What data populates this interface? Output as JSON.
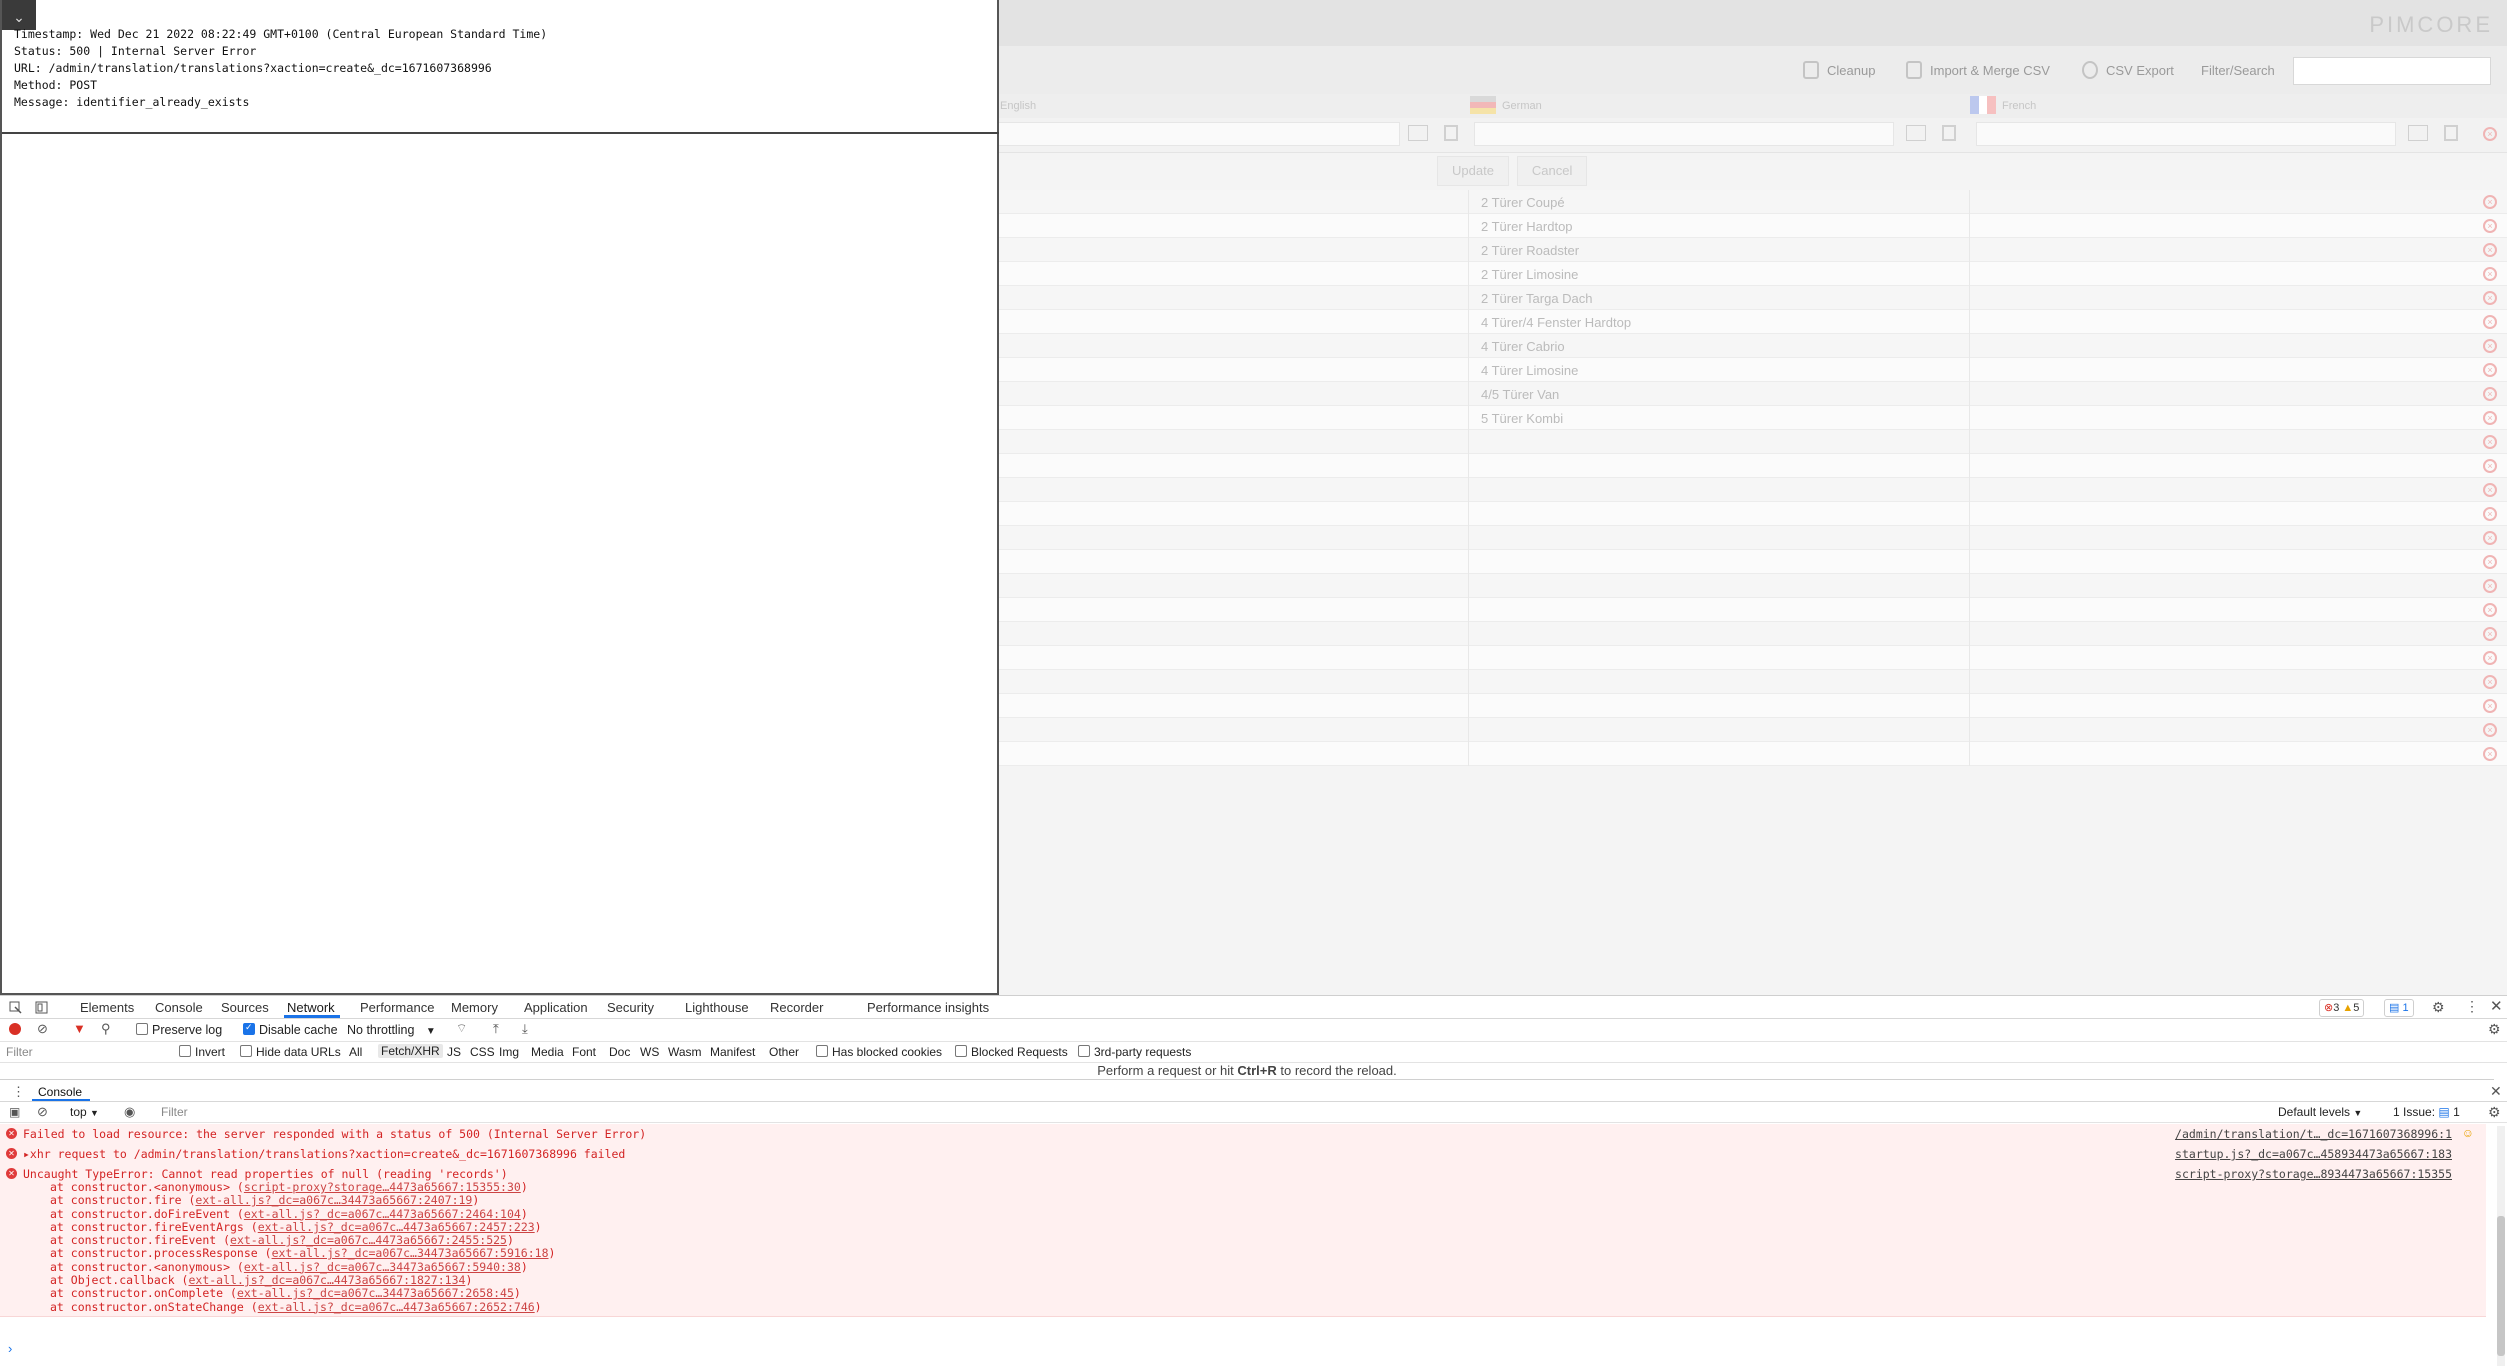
{
  "app": {
    "logo_text": "PIMCORE",
    "toolbar": {
      "cleanup": "Cleanup",
      "import_merge": "Import & Merge CSV",
      "csv_export": "CSV Export",
      "filter_label": "Filter/Search"
    },
    "columns": {
      "english": "English",
      "german": "German",
      "french": "French"
    },
    "row_editor": {
      "update": "Update",
      "cancel": "Cancel"
    },
    "rows": [
      "2 Türer Coupé",
      "2 Türer Hardtop",
      "2 Türer Roadster",
      "2 Türer Limosine",
      "2 Türer Targa Dach",
      "4 Türer/4 Fenster Hardtop",
      "4 Türer Cabrio",
      "4 Türer Limosine",
      "4/5 Türer Van",
      "5 Türer Kombi",
      "",
      "",
      "",
      "",
      "",
      "",
      "",
      "",
      "",
      "",
      "",
      "",
      "",
      ""
    ]
  },
  "error": {
    "timestamp": "Timestamp: Wed Dec 21 2022 08:22:49 GMT+0100 (Central European Standard Time)",
    "status": "Status: 500 | Internal Server Error",
    "url": "URL: /admin/translation/translations?xaction=create&_dc=1671607368996",
    "method": "Method: POST",
    "message": "Message: identifier_already_exists"
  },
  "devtools": {
    "tabs": [
      "Elements",
      "Console",
      "Sources",
      "Network",
      "Performance",
      "Memory",
      "Application",
      "Security",
      "Lighthouse",
      "Recorder",
      "Performance insights"
    ],
    "counts": {
      "errors": "3",
      "warnings": "5",
      "messages": "1"
    },
    "network": {
      "preserve_log": "Preserve log",
      "disable_cache": "Disable cache",
      "throttling": "No throttling"
    },
    "filter": {
      "placeholder": "Filter",
      "invert": "Invert",
      "hide_data_urls": "Hide data URLs",
      "types": [
        "All",
        "Fetch/XHR",
        "JS",
        "CSS",
        "Img",
        "Media",
        "Font",
        "Doc",
        "WS",
        "Wasm",
        "Manifest",
        "Other"
      ],
      "blocked_cookies": "Has blocked cookies",
      "blocked_requests": "Blocked Requests",
      "third_party": "3rd-party requests"
    },
    "record_msg_pre": "Perform a request or hit ",
    "record_msg_key": "Ctrl+R",
    "record_msg_post": " to record the reload.",
    "drawer_tab": "Console",
    "console": {
      "context": "top",
      "filter_placeholder": "Filter",
      "levels": "Default levels",
      "issues": "1 Issue:",
      "issues_count": "1"
    },
    "messages": [
      {
        "text": "Failed to load resource: the server responded with a status of 500 (Internal Server Error)",
        "source": "/admin/translation/t…_dc=1671607368996:1"
      },
      {
        "text": "▸xhr request to /admin/translation/translations?xaction=create&_dc=1671607368996 failed",
        "source": "startup.js?_dc=a067c…458934473a65667:183"
      },
      {
        "text": "Uncaught TypeError: Cannot read properties of null (reading 'records')",
        "source": "script-proxy?storage…8934473a65667:15355"
      }
    ],
    "stack": [
      {
        "pre": "at constructor.<anonymous> (",
        "link": "script-proxy?storage…4473a65667:15355:30",
        "post": ")"
      },
      {
        "pre": "at constructor.fire (",
        "link": "ext-all.js?_dc=a067c…34473a65667:2407:19",
        "post": ")"
      },
      {
        "pre": "at constructor.doFireEvent (",
        "link": "ext-all.js?_dc=a067c…4473a65667:2464:104",
        "post": ")"
      },
      {
        "pre": "at constructor.fireEventArgs (",
        "link": "ext-all.js?_dc=a067c…4473a65667:2457:223",
        "post": ")"
      },
      {
        "pre": "at constructor.fireEvent (",
        "link": "ext-all.js?_dc=a067c…4473a65667:2455:525",
        "post": ")"
      },
      {
        "pre": "at constructor.processResponse (",
        "link": "ext-all.js?_dc=a067c…34473a65667:5916:18",
        "post": ")"
      },
      {
        "pre": "at constructor.<anonymous> (",
        "link": "ext-all.js?_dc=a067c…34473a65667:5940:38",
        "post": ")"
      },
      {
        "pre": "at Object.callback (",
        "link": "ext-all.js?_dc=a067c…4473a65667:1827:134",
        "post": ")"
      },
      {
        "pre": "at constructor.onComplete (",
        "link": "ext-all.js?_dc=a067c…34473a65667:2658:45",
        "post": ")"
      },
      {
        "pre": "at constructor.onStateChange (",
        "link": "ext-all.js?_dc=a067c…4473a65667:2652:746",
        "post": ")"
      }
    ],
    "prompt": "›"
  }
}
